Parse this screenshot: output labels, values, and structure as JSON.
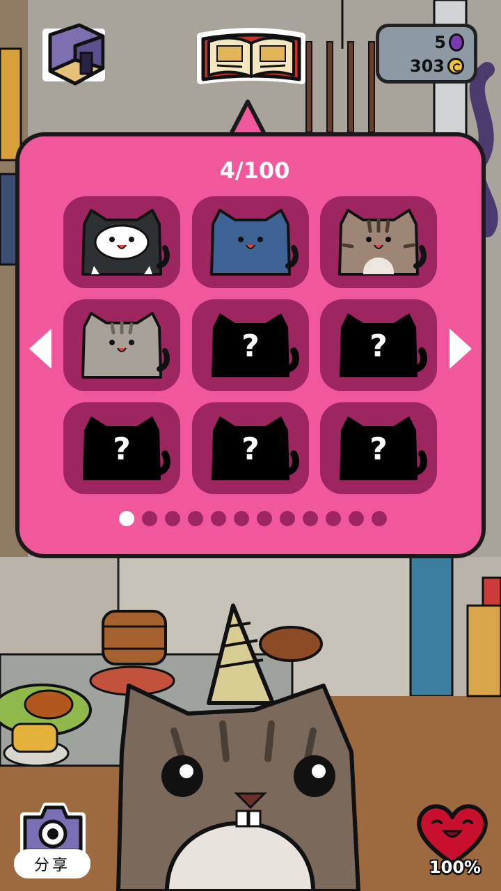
{
  "collection": {
    "count_label": "4/100",
    "slots": [
      {
        "status": "unlocked",
        "icon": "black-white-cat-icon"
      },
      {
        "status": "unlocked",
        "icon": "blue-cat-icon"
      },
      {
        "status": "unlocked",
        "icon": "tabby-cat-icon"
      },
      {
        "status": "unlocked",
        "icon": "grey-tabby-cat-icon"
      },
      {
        "status": "locked",
        "icon": "unknown-cat-icon"
      },
      {
        "status": "locked",
        "icon": "unknown-cat-icon"
      },
      {
        "status": "locked",
        "icon": "unknown-cat-icon"
      },
      {
        "status": "locked",
        "icon": "unknown-cat-icon"
      },
      {
        "status": "locked",
        "icon": "unknown-cat-icon"
      }
    ],
    "unknown_mark": "?",
    "page": {
      "current": 1,
      "total": 12
    }
  },
  "currency": {
    "gems": "5",
    "coins": "303"
  },
  "share": {
    "label": "分享",
    "icon": "camera-icon"
  },
  "happiness": {
    "label": "100%",
    "icon": "heart-icon"
  },
  "colors": {
    "panel": "#f1589b",
    "slot": "#9d2560",
    "accent": "#ffffff"
  }
}
